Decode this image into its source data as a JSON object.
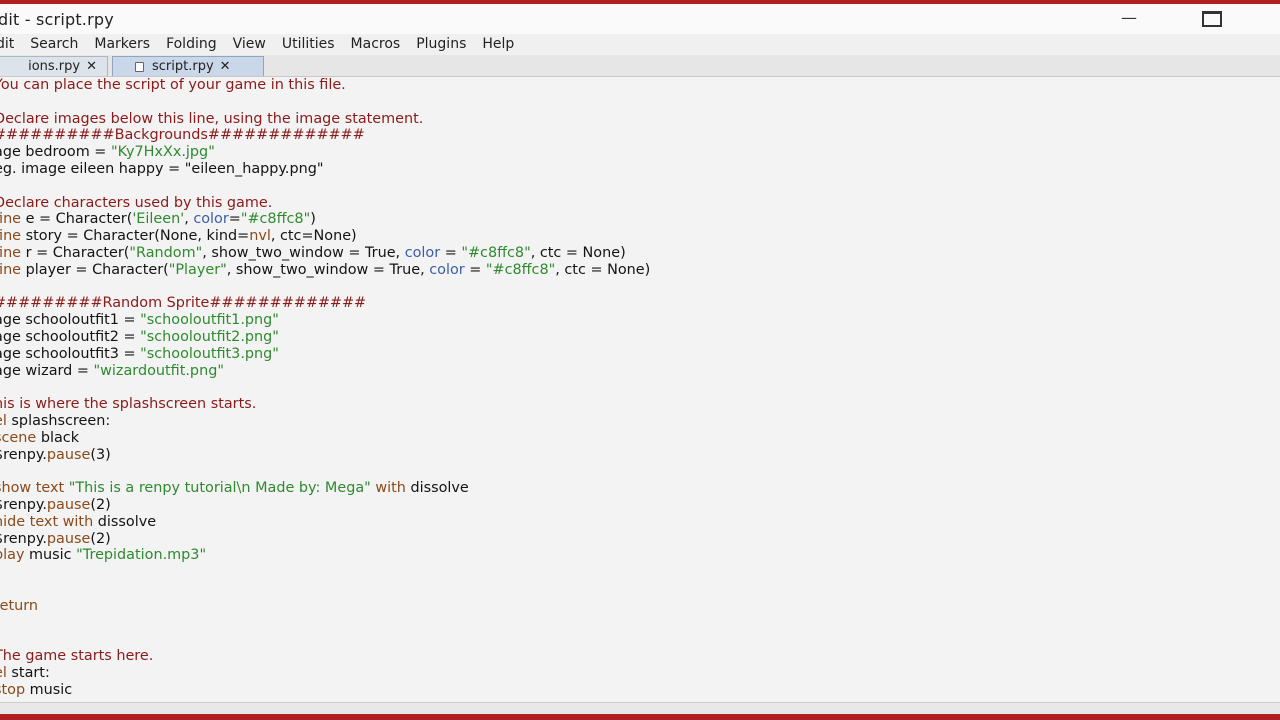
{
  "window": {
    "title": "dit - script.rpy"
  },
  "menu": [
    "dit",
    "Search",
    "Markers",
    "Folding",
    "View",
    "Utilities",
    "Macros",
    "Plugins",
    "Help"
  ],
  "tabs": [
    {
      "label": "ions.rpy",
      "close": "✕"
    },
    {
      "label": "script.rpy",
      "close": "✕"
    }
  ],
  "code_lines": [
    [
      {
        "t": "You can place the script of your game in this file.",
        "c": "comment"
      }
    ],
    [],
    [
      {
        "t": "Declare images below this line, using the image statement.",
        "c": "comment"
      }
    ],
    [
      {
        "t": "##########Backgrounds#############",
        "c": "comment"
      }
    ],
    [
      {
        "t": "age bedroom = "
      },
      {
        "t": "\"Ky7HxXx.jpg\"",
        "c": "string"
      }
    ],
    [
      {
        "t": "eg. image eileen happy = \"eileen_happy.png\""
      }
    ],
    [],
    [
      {
        "t": "Declare characters used by this game.",
        "c": "comment"
      }
    ],
    [
      {
        "t": "fine",
        "c": "keyword"
      },
      {
        "t": " e = Character("
      },
      {
        "t": "'Eileen'",
        "c": "string"
      },
      {
        "t": ", "
      },
      {
        "t": "color",
        "c": "param"
      },
      {
        "t": "="
      },
      {
        "t": "\"#c8ffc8\"",
        "c": "string"
      },
      {
        "t": ")"
      }
    ],
    [
      {
        "t": "fine",
        "c": "keyword"
      },
      {
        "t": " story = Character(None, kind="
      },
      {
        "t": "nvl",
        "c": "keyword"
      },
      {
        "t": ", ctc=None)"
      }
    ],
    [
      {
        "t": "fine",
        "c": "keyword"
      },
      {
        "t": " r = Character("
      },
      {
        "t": "\"Random\"",
        "c": "string"
      },
      {
        "t": ", show_two_window = True, "
      },
      {
        "t": "color",
        "c": "param"
      },
      {
        "t": " = "
      },
      {
        "t": "\"#c8ffc8\"",
        "c": "string"
      },
      {
        "t": ", ctc = None)"
      }
    ],
    [
      {
        "t": "fine",
        "c": "keyword"
      },
      {
        "t": " player = Character("
      },
      {
        "t": "\"Player\"",
        "c": "string"
      },
      {
        "t": ", show_two_window = True, "
      },
      {
        "t": "color",
        "c": "param"
      },
      {
        "t": " = "
      },
      {
        "t": "\"#c8ffc8\"",
        "c": "string"
      },
      {
        "t": ", ctc = None)"
      }
    ],
    [],
    [
      {
        "t": "#########Random Sprite#############",
        "c": "comment"
      }
    ],
    [
      {
        "t": "age schooloutfit1 = "
      },
      {
        "t": "\"schooloutfit1.png\"",
        "c": "string"
      }
    ],
    [
      {
        "t": "age schooloutfit2 = "
      },
      {
        "t": "\"schooloutfit2.png\"",
        "c": "string"
      }
    ],
    [
      {
        "t": "age schooloutfit3 = "
      },
      {
        "t": "\"schooloutfit3.png\"",
        "c": "string"
      }
    ],
    [
      {
        "t": "age wizard = "
      },
      {
        "t": "\"wizardoutfit.png\"",
        "c": "string"
      }
    ],
    [],
    [
      {
        "t": "his is where the splashscreen starts.",
        "c": "comment"
      }
    ],
    [
      {
        "t": "el",
        "c": "keyword"
      },
      {
        "t": " splashscreen:"
      }
    ],
    [
      {
        "t": "scene",
        "c": "keyword"
      },
      {
        "t": " black"
      }
    ],
    [
      {
        "t": "$renpy."
      },
      {
        "t": "pause",
        "c": "keyword"
      },
      {
        "t": "(3)"
      }
    ],
    [],
    [
      {
        "t": "show text ",
        "c": "keyword"
      },
      {
        "t": "\"This is a renpy tutorial\\n Made by: Mega\"",
        "c": "string"
      },
      {
        "t": " with",
        "c": "keyword"
      },
      {
        "t": " dissolve"
      }
    ],
    [
      {
        "t": "$renpy."
      },
      {
        "t": "pause",
        "c": "keyword"
      },
      {
        "t": "(2)"
      }
    ],
    [
      {
        "t": "hide text with",
        "c": "keyword"
      },
      {
        "t": " dissolve"
      }
    ],
    [
      {
        "t": "$renpy."
      },
      {
        "t": "pause",
        "c": "keyword"
      },
      {
        "t": "(2)"
      }
    ],
    [
      {
        "t": "play",
        "c": "keyword"
      },
      {
        "t": " music "
      },
      {
        "t": "\"Trepidation.mp3\"",
        "c": "string"
      }
    ],
    [],
    [],
    [
      {
        "t": "return",
        "c": "keyword"
      }
    ],
    [],
    [],
    [
      {
        "t": "The game starts here.",
        "c": "comment"
      }
    ],
    [
      {
        "t": "el",
        "c": "keyword"
      },
      {
        "t": " start:"
      }
    ],
    [
      {
        "t": "stop",
        "c": "keyword"
      },
      {
        "t": " music"
      }
    ]
  ]
}
